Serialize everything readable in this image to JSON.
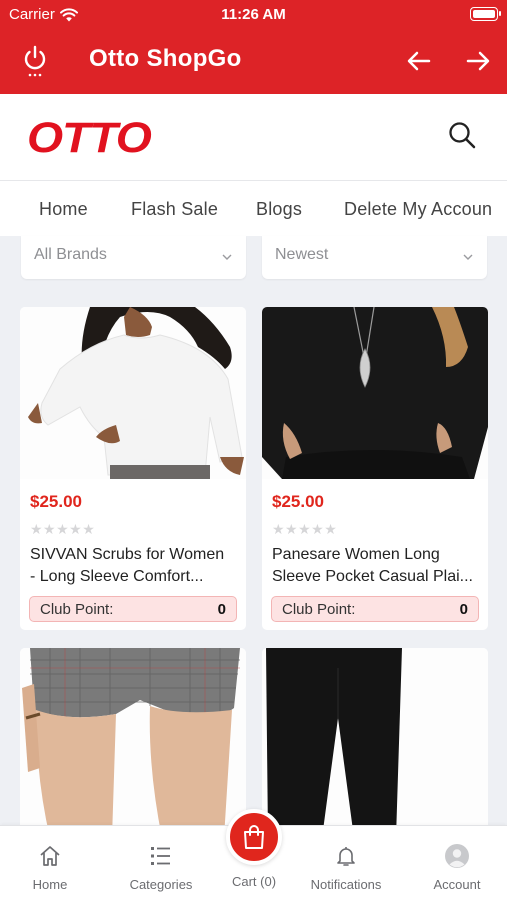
{
  "status_bar": {
    "carrier": "Carrier",
    "time": "11:26 AM"
  },
  "app_bar": {
    "title": "Otto ShopGo"
  },
  "brand": {
    "logo_text": "OTTO",
    "logo_color": "#e1121f",
    "accent_color": "#dd2327"
  },
  "tabs": [
    "Home",
    "Flash Sale",
    "Blogs",
    "Delete My Accoun"
  ],
  "filters": {
    "brand": "All Brands",
    "sort": "Newest"
  },
  "products": [
    {
      "price": "$25.00",
      "rating_stars": "★★★★★",
      "rating_value": 0,
      "name_line1": "SIVVAN Scrubs for Women",
      "name_line2": "- Long Sleeve Comfort...",
      "club_label": "Club Point:",
      "club_points": "0"
    },
    {
      "price": "$25.00",
      "rating_stars": "★★★★★",
      "rating_value": 0,
      "name_line1": "Panesare Women Long",
      "name_line2": "Sleeve Pocket Casual Plai...",
      "club_label": "Club Point:",
      "club_points": "0"
    }
  ],
  "bottom_nav": {
    "home": "Home",
    "categories": "Categories",
    "cart": "Cart (0)",
    "notifications": "Notifications",
    "account": "Account"
  },
  "icons": [
    "wifi-icon",
    "battery-icon",
    "power-icon",
    "arrow-left-icon",
    "arrow-right-icon",
    "search-icon",
    "chevron-down-icon",
    "star-icon",
    "home-icon",
    "categories-icon",
    "shopping-bag-icon",
    "bell-icon",
    "avatar-icon"
  ]
}
